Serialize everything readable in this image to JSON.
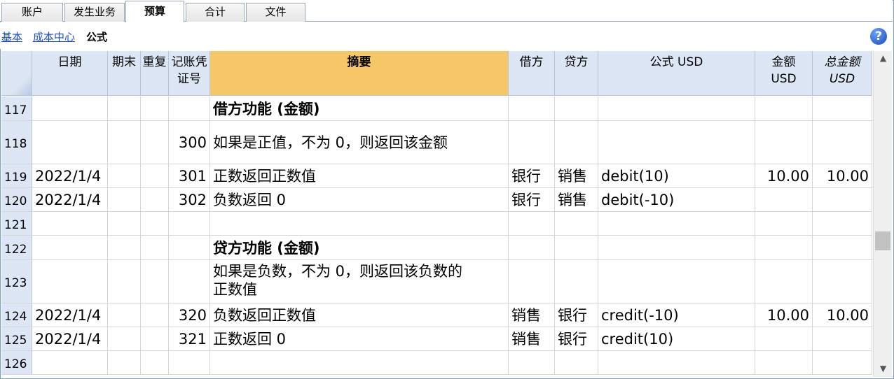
{
  "tabs": [
    "账户",
    "发生业务",
    "预算",
    "合计",
    "文件"
  ],
  "active_tab": "预算",
  "views": {
    "basic": "基本",
    "cost_center": "成本中心",
    "formula": "公式"
  },
  "help_label": "?",
  "columns": {
    "date": "日期",
    "end": "期末",
    "repeat": "重复",
    "doc_line1": "记账凭",
    "doc_line2": "证号",
    "summary": "摘要",
    "debit": "借方",
    "credit": "贷方",
    "formula": "公式 USD",
    "amount_line1": "金额",
    "amount_line2": "USD",
    "total_line1": "总金额",
    "total_line2": "USD"
  },
  "rows": [
    {
      "num": "117",
      "date": "",
      "doc": "",
      "desc": "借方功能 (金额)",
      "desc2": "",
      "debit": "",
      "credit": "",
      "formula": "",
      "amount": "",
      "total": ""
    },
    {
      "num": "118",
      "date": "",
      "doc": "300",
      "desc": "如果是正值，不为 0，则返回该金额",
      "desc2": "",
      "debit": "",
      "credit": "",
      "formula": "",
      "amount": "",
      "total": ""
    },
    {
      "num": "119",
      "date": "2022/1/4",
      "doc": "301",
      "desc": "正数返回正数值",
      "desc2": "",
      "debit": "银行",
      "credit": "销售",
      "formula": "debit(10)",
      "amount": "10.00",
      "total": "10.00"
    },
    {
      "num": "120",
      "date": "2022/1/4",
      "doc": "302",
      "desc": "负数返回 0",
      "desc2": "",
      "debit": "银行",
      "credit": "销售",
      "formula": "debit(-10)",
      "amount": "",
      "total": ""
    },
    {
      "num": "121",
      "date": "",
      "doc": "",
      "desc": "",
      "desc2": "",
      "debit": "",
      "credit": "",
      "formula": "",
      "amount": "",
      "total": ""
    },
    {
      "num": "122",
      "date": "",
      "doc": "",
      "desc": "贷方功能 (金额)",
      "desc2": "",
      "debit": "",
      "credit": "",
      "formula": "",
      "amount": "",
      "total": ""
    },
    {
      "num": "123",
      "date": "",
      "doc": "",
      "desc": "如果是负数，不为 0，则返回该负数的",
      "desc2": "正数值",
      "debit": "",
      "credit": "",
      "formula": "",
      "amount": "",
      "total": ""
    },
    {
      "num": "124",
      "date": "2022/1/4",
      "doc": "320",
      "desc": "负数返回正数值",
      "desc2": "",
      "debit": "销售",
      "credit": "银行",
      "formula": "credit(-10)",
      "amount": "10.00",
      "total": "10.00"
    },
    {
      "num": "125",
      "date": "2022/1/4",
      "doc": "321",
      "desc": "正数返回 0",
      "desc2": "",
      "debit": "销售",
      "credit": "银行",
      "formula": "credit(10)",
      "amount": "",
      "total": ""
    },
    {
      "num": "126",
      "date": "",
      "doc": "",
      "desc": "",
      "desc2": "",
      "debit": "",
      "credit": "",
      "formula": "",
      "amount": "",
      "total": ""
    }
  ],
  "scrollbar_position": 0.6
}
